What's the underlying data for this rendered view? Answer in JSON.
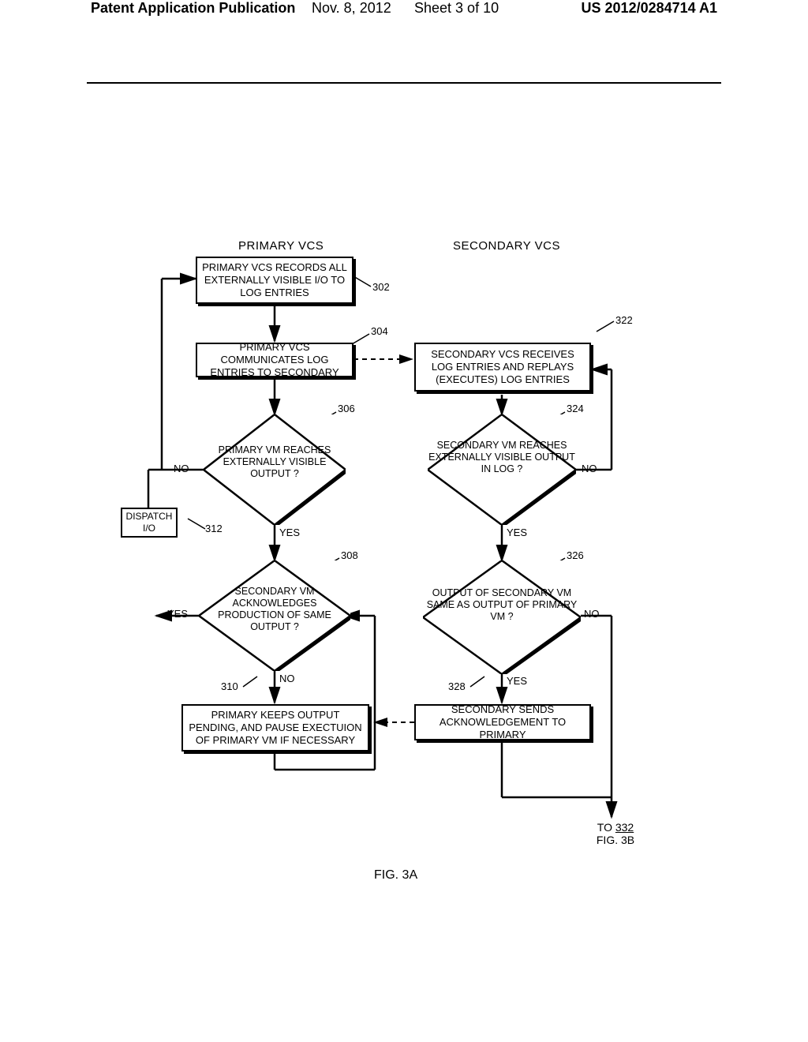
{
  "header": {
    "left": "Patent Application Publication",
    "date": "Nov. 8, 2012",
    "sheet": "Sheet 3 of 10",
    "pubno": "US 2012/0284714 A1"
  },
  "cols": {
    "primary": "PRIMARY VCS",
    "secondary": "SECONDARY VCS"
  },
  "boxes": {
    "b302": "PRIMARY VCS RECORDS ALL EXTERNALLY VISIBLE I/O TO LOG ENTRIES",
    "b304": "PRIMARY VCS COMMUNICATES LOG ENTRIES TO SECONDARY",
    "b312": "DISPATCH I/O",
    "b310": "PRIMARY KEEPS OUTPUT PENDING, AND PAUSE EXECTUION OF PRIMARY VM IF NECESSARY",
    "b322": "SECONDARY VCS RECEIVES LOG ENTRIES AND REPLAYS (EXECUTES) LOG ENTRIES",
    "b328": "SECONDARY SENDS ACKNOWLEDGEMENT TO PRIMARY"
  },
  "diamonds": {
    "d306": "PRIMARY VM REACHES EXTERNALLY VISIBLE OUTPUT ?",
    "d308": "SECONDARY VM ACKNOWLEDGES PRODUCTION OF SAME OUTPUT ?",
    "d324": "SECONDARY VM REACHES EXTERNALLY VISIBLE OUTPUT IN LOG ?",
    "d326": "OUTPUT OF SECONDARY VM SAME AS OUTPUT OF PRIMARY VM ?"
  },
  "labels": {
    "no": "NO",
    "yes": "YES",
    "n302": "302",
    "n304": "304",
    "n306": "306",
    "n308": "308",
    "n310": "310",
    "n312": "312",
    "n322": "322",
    "n324": "324",
    "n326": "326",
    "n328": "328"
  },
  "footer": {
    "to332a": "TO ",
    "to332b": "332",
    "to332c": "FIG. 3B",
    "fig": "FIG. 3A"
  }
}
